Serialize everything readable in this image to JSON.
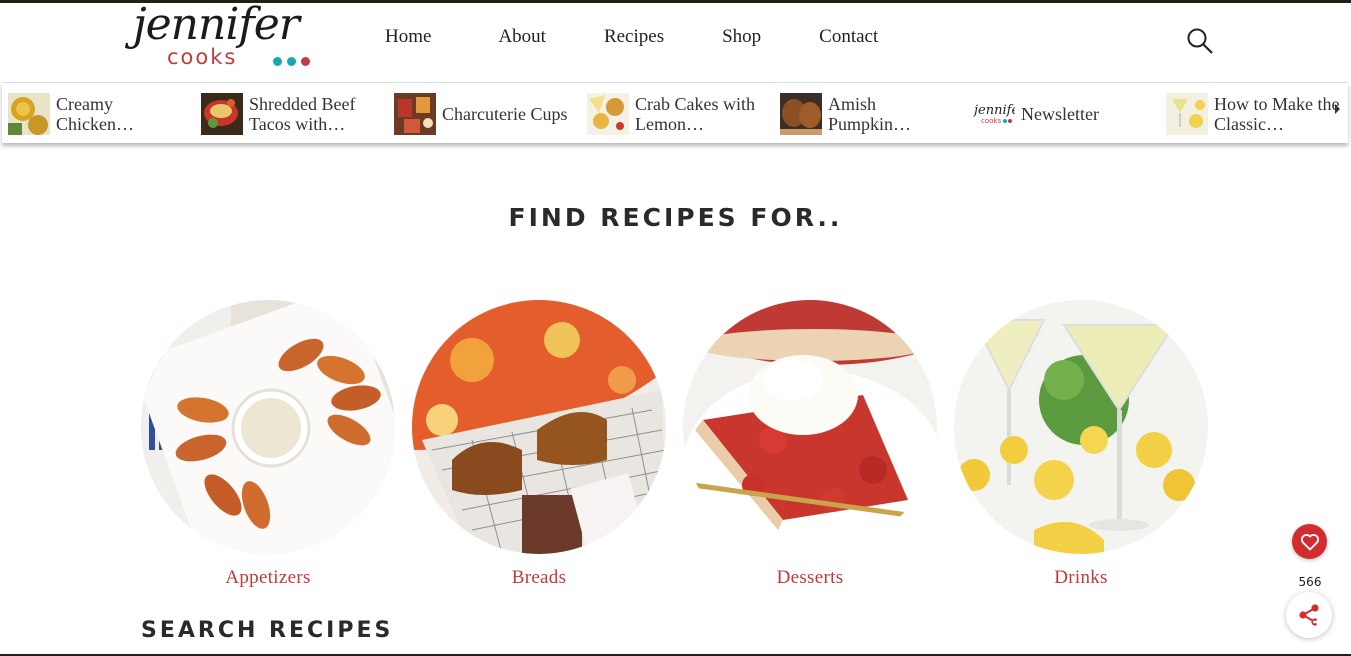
{
  "brand": {
    "script": "jennifer",
    "sub": "cooks",
    "dot_colors": [
      "#c53a3f",
      "#1aa7b5",
      "#1aa7b5",
      "#c53a3f"
    ]
  },
  "nav": {
    "items": [
      "Home",
      "About",
      "Recipes",
      "Shop",
      "Contact"
    ]
  },
  "strip": {
    "items": [
      {
        "title": "Creamy Chicken…",
        "icon": "soup-thumbnail"
      },
      {
        "title": "Shredded Beef Tacos with…",
        "icon": "tacos-thumbnail"
      },
      {
        "title": "Charcuterie Cups",
        "icon": "charcuterie-thumbnail"
      },
      {
        "title": "Crab Cakes with Lemon…",
        "icon": "crab-cakes-thumbnail"
      },
      {
        "title": "Amish Pumpkin…",
        "icon": "pumpkin-bread-thumbnail"
      },
      {
        "title": "Newsletter",
        "icon": "newsletter-logo"
      },
      {
        "title": "How to Make the Classic…",
        "icon": "drink-thumbnail"
      }
    ]
  },
  "main": {
    "find_title": "FIND RECIPES FOR..",
    "categories": [
      "Appetizers",
      "Breads",
      "Desserts",
      "Drinks"
    ],
    "search_title": "SEARCH RECIPES"
  },
  "share": {
    "count": "566"
  },
  "colors": {
    "accent": "#c0393d",
    "fav": "#d22c2f"
  }
}
